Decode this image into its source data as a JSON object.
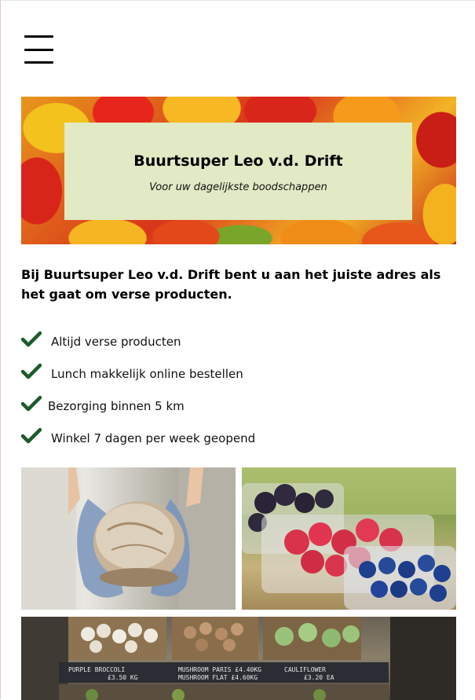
{
  "header": {
    "menu_icon": "hamburger-menu-icon"
  },
  "hero": {
    "title": "Buurtsuper Leo v.d. Drift",
    "subtitle": "Voor uw dagelijkste boodschappen"
  },
  "intro": "Bij Buurtsuper Leo v.d. Drift bent u aan het juiste adres als het gaat om verse producten.",
  "features": [
    {
      "label": "Altijd verse producten",
      "icon": "checkmark-icon"
    },
    {
      "label": "Lunch makkelijk online bestellen",
      "icon": "checkmark-icon"
    },
    {
      "label": "Bezorging binnen 5 km",
      "icon": "checkmark-icon"
    },
    {
      "label": "Winkel 7 dagen per week geopend",
      "icon": "checkmark-icon"
    }
  ],
  "market_signs": {
    "sign_1": "PURPLE BROCCOLI",
    "sign_1_price": "£3.50 KG",
    "sign_2": "MUSHROOM PARIS £4.40KG",
    "sign_3": "MUSHROOM FLAT £4.60KG",
    "sign_4": "CAULIFLOWER",
    "sign_4_price": "£3.20 EA"
  },
  "colors": {
    "accent_green": "#1d5a2c",
    "hero_box": "#e1e9c5"
  }
}
